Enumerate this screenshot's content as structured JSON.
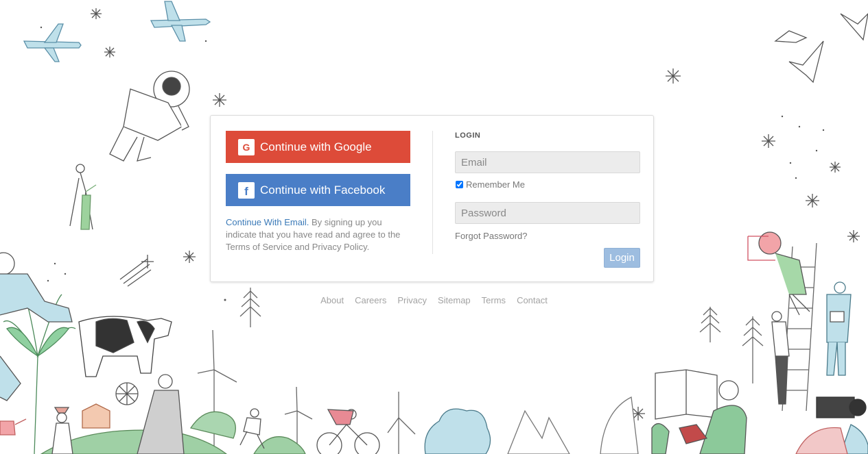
{
  "social": {
    "google_label": "Continue with Google",
    "google_icon": "google-g-icon",
    "google_icon_glyph": "G",
    "facebook_label": "Continue with Facebook",
    "facebook_icon": "facebook-f-icon",
    "facebook_icon_glyph": "f"
  },
  "terms": {
    "email_link": "Continue With Email.",
    "text": " By signing up you indicate that you have read and agree to the Terms of Service and Privacy Policy."
  },
  "login": {
    "heading": "LOGIN",
    "email_placeholder": "Email",
    "email_value": "",
    "remember_label": "Remember Me",
    "remember_checked": true,
    "password_placeholder": "Password",
    "password_value": "",
    "forgot_label": "Forgot Password?",
    "submit_label": "Login"
  },
  "footer": {
    "links": [
      "About",
      "Careers",
      "Privacy",
      "Sitemap",
      "Terms",
      "Contact"
    ]
  },
  "colors": {
    "google": "#dd4b39",
    "facebook": "#4a7ec7",
    "link": "#3b7ab8",
    "login_button": "#9dbde0"
  }
}
